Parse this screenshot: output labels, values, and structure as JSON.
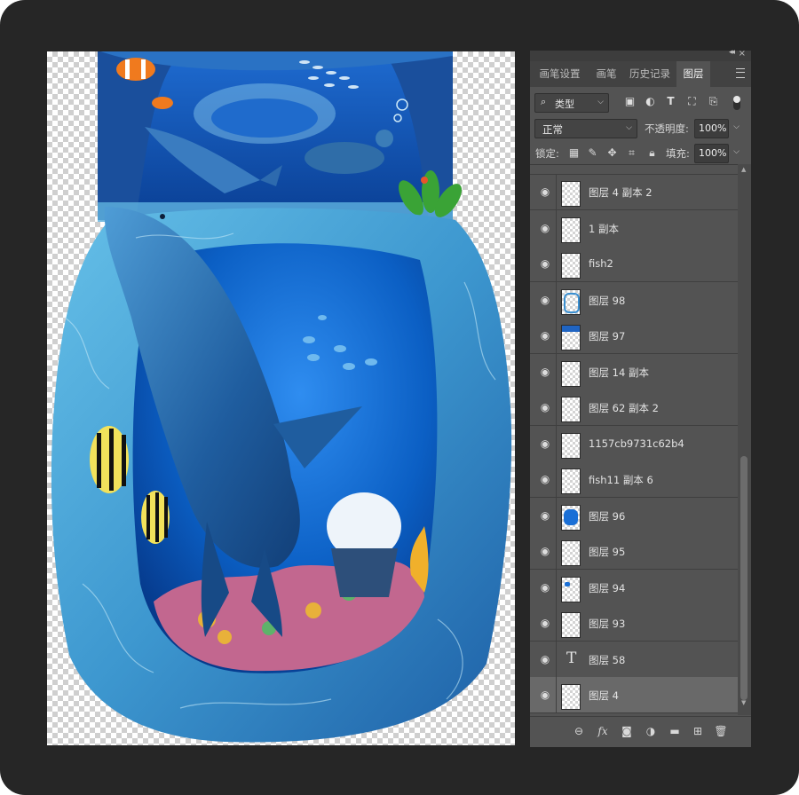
{
  "panel": {
    "tabs": [
      {
        "label": "画笔设置"
      },
      {
        "label": "画笔"
      },
      {
        "label": "历史记录"
      },
      {
        "label": "图层"
      }
    ],
    "filter": {
      "label": "类型"
    },
    "blend_mode": "正常",
    "opacity_label": "不透明度:",
    "opacity_value": "100%",
    "lock_label": "锁定:",
    "fill_label": "填充:",
    "fill_value": "100%"
  },
  "layers": [
    {
      "name": "图层 4 副本 2",
      "thumb": "empty",
      "visible": true
    },
    {
      "name": "1 副本",
      "thumb": "empty",
      "visible": true
    },
    {
      "name": "fish2",
      "thumb": "empty",
      "visible": true
    },
    {
      "name": "图层 98",
      "thumb": "arch",
      "visible": true
    },
    {
      "name": "图层 97",
      "thumb": "top-strip",
      "visible": true
    },
    {
      "name": "图层 14 副本",
      "thumb": "empty",
      "visible": true
    },
    {
      "name": "图层 62 副本 2",
      "thumb": "empty",
      "visible": true
    },
    {
      "name": "1157cb9731c62b4",
      "thumb": "empty",
      "visible": true
    },
    {
      "name": "fish11 副本 6",
      "thumb": "empty",
      "visible": true
    },
    {
      "name": "图层 96",
      "thumb": "blue-blob",
      "visible": true
    },
    {
      "name": "图层 95",
      "thumb": "empty",
      "visible": true
    },
    {
      "name": "图层 94",
      "thumb": "small-dot",
      "visible": true
    },
    {
      "name": "图层 93",
      "thumb": "empty",
      "visible": true
    },
    {
      "name": "图层 58",
      "thumb": "type",
      "visible": true
    },
    {
      "name": "图层 4",
      "thumb": "empty",
      "visible": true,
      "selected": true
    }
  ],
  "icons": {
    "eye": "eye-icon",
    "filter_search": "search-icon",
    "filter_pixel": "image-filter-icon",
    "filter_adjustment": "adjustment-filter-icon",
    "filter_type": "type-filter-icon",
    "filter_shape": "shape-filter-icon",
    "filter_smart": "smart-object-filter-icon",
    "footer": [
      "link-icon",
      "fx-icon",
      "mask-icon",
      "adjustment-layer-icon",
      "folder-icon",
      "new-layer-icon",
      "trash-icon"
    ]
  },
  "colors": {
    "app_background": "#262626",
    "panel": "#535353",
    "selected_row": "#696969",
    "ocean_blue": "#0b5fc4",
    "rock_light": "#4aa9d8"
  }
}
